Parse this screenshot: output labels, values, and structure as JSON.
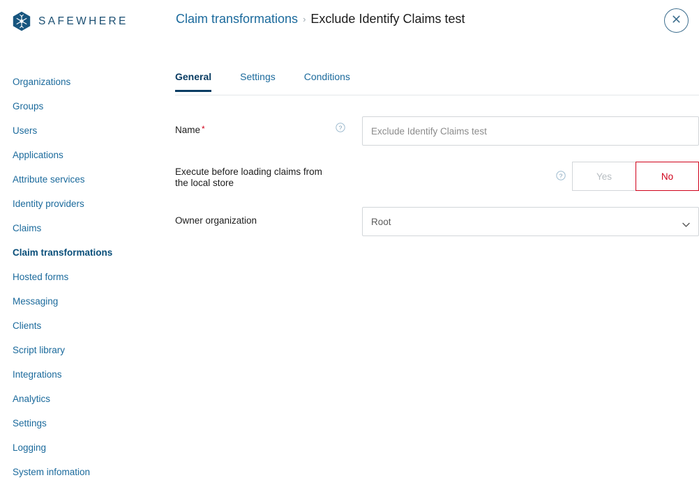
{
  "brand": {
    "name": "SAFEWHERE",
    "logo_icon": "snowflake-hexagon-icon",
    "logo_color": "#18567f"
  },
  "breadcrumb": {
    "parent": "Claim transformations",
    "separator": "›",
    "current": "Exclude Identify Claims test"
  },
  "close_button": {
    "icon": "close-x-circle-icon",
    "label": "Close",
    "color": "#3d6e8e"
  },
  "sidebar": {
    "items": [
      {
        "label": "Organizations",
        "active": false
      },
      {
        "label": "Groups",
        "active": false
      },
      {
        "label": "Users",
        "active": false
      },
      {
        "label": "Applications",
        "active": false
      },
      {
        "label": "Attribute services",
        "active": false
      },
      {
        "label": "Identity providers",
        "active": false
      },
      {
        "label": "Claims",
        "active": false
      },
      {
        "label": "Claim transformations",
        "active": true
      },
      {
        "label": "Hosted forms",
        "active": false
      },
      {
        "label": "Messaging",
        "active": false
      },
      {
        "label": "Clients",
        "active": false
      },
      {
        "label": "Script library",
        "active": false
      },
      {
        "label": "Integrations",
        "active": false
      },
      {
        "label": "Analytics",
        "active": false
      },
      {
        "label": "Settings",
        "active": false
      },
      {
        "label": "Logging",
        "active": false
      },
      {
        "label": "System infomation",
        "active": false
      }
    ]
  },
  "tabs": [
    {
      "label": "General",
      "active": true
    },
    {
      "label": "Settings",
      "active": false
    },
    {
      "label": "Conditions",
      "active": false
    }
  ],
  "form": {
    "name_field": {
      "label": "Name",
      "required_marker": "*",
      "help_icon": "question-circle-icon",
      "value": "Exclude Identify Claims test",
      "placeholder": "Exclude Identify Claims test"
    },
    "execute_before_field": {
      "label": "Execute before loading claims from the local store",
      "help_icon": "question-circle-icon",
      "yes_label": "Yes",
      "no_label": "No",
      "selected": "No",
      "selected_color": "#d0021b"
    },
    "owner_org_field": {
      "label": "Owner organization",
      "value": "Root",
      "caret_icon": "chevron-down-icon"
    }
  }
}
